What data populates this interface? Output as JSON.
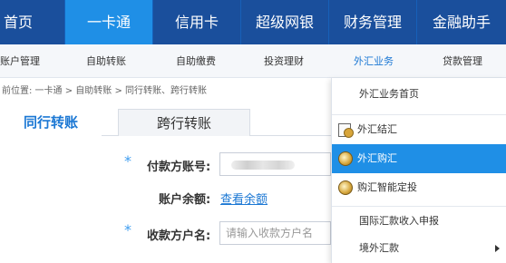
{
  "topnav": {
    "items": [
      {
        "label": "首页"
      },
      {
        "label": "一卡通"
      },
      {
        "label": "信用卡"
      },
      {
        "label": "超级网银"
      },
      {
        "label": "财务管理"
      },
      {
        "label": "金融助手"
      }
    ]
  },
  "subnav": {
    "items": [
      {
        "label": "账户管理"
      },
      {
        "label": "自助转账"
      },
      {
        "label": "自助缴费"
      },
      {
        "label": "投资理财"
      },
      {
        "label": "外汇业务"
      },
      {
        "label": "贷款管理"
      }
    ]
  },
  "breadcrumb": {
    "text": "前位置: 一卡通 > 自助转账 > 同行转账、跨行转账"
  },
  "tabs": {
    "active": "同行转账",
    "inactive": "跨行转账"
  },
  "form": {
    "payer_label": "付款方账号:",
    "balance_label": "账户余额:",
    "balance_link": "查看余额",
    "payee_label": "收款方户名:",
    "payee_placeholder": "请输入收款方户名",
    "required_mark": "*"
  },
  "dropdown": {
    "items": [
      {
        "label": "外汇业务首页",
        "icon": ""
      },
      {
        "label": "外汇结汇",
        "icon": "calculator-coin-icon"
      },
      {
        "label": "外汇购汇",
        "icon": "coin-icon"
      },
      {
        "label": "购汇智能定投",
        "icon": "coin-icon"
      },
      {
        "label": "国际汇款收入申报",
        "icon": ""
      },
      {
        "label": "境外汇款",
        "icon": "chevron-right-icon"
      }
    ],
    "active_color": "#1f8fe6"
  },
  "colors": {
    "nav_bg": "#1a4f9c",
    "nav_active": "#1f8fe6",
    "link": "#1c78d4"
  }
}
